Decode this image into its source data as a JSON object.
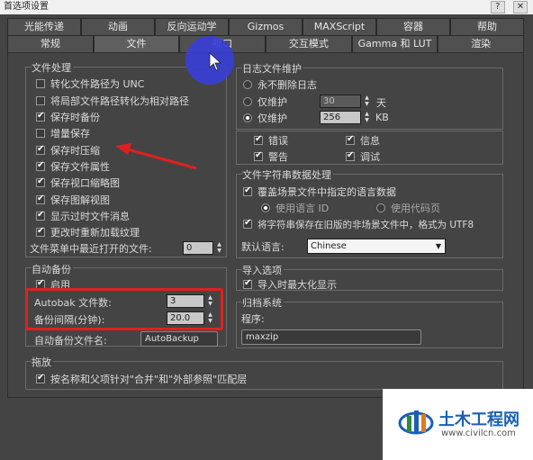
{
  "window": {
    "title": "首选项设置",
    "controls": [
      "?",
      "✕"
    ]
  },
  "tabs_row1": [
    "光能传递",
    "动画",
    "反向运动学",
    "Gizmos",
    "MAXScript",
    "容器",
    "帮助"
  ],
  "tabs_row2": [
    "常规",
    "文件",
    "视口",
    "交互模式",
    "Gamma 和 LUT",
    "渲染"
  ],
  "file_handling": {
    "title": "文件处理",
    "items": [
      {
        "label": "转化文件路径为 UNC",
        "checked": false
      },
      {
        "label": "将局部文件路径转化为相对路径",
        "checked": false
      },
      {
        "label": "保存时备份",
        "checked": true
      },
      {
        "label": "增量保存",
        "checked": false
      },
      {
        "label": "保存时压缩",
        "checked": true
      },
      {
        "label": "保存文件属性",
        "checked": true
      },
      {
        "label": "保存视口缩略图",
        "checked": true
      },
      {
        "label": "保存图解视图",
        "checked": true
      },
      {
        "label": "显示过时文件消息",
        "checked": true
      },
      {
        "label": "更改时重新加载纹理",
        "checked": true
      }
    ],
    "recent_label": "文件菜单中最近打开的文件:",
    "recent_value": "0"
  },
  "autobackup": {
    "title": "自动备份",
    "enable_label": "启用",
    "enable_checked": true,
    "count_label": "Autobak 文件数:",
    "count_value": "3",
    "interval_label": "备份间隔(分钟):",
    "interval_value": "20.0",
    "name_label": "自动备份文件名:",
    "name_value": "AutoBackup"
  },
  "log": {
    "title": "日志文件维护",
    "never_delete": "永不删除日志",
    "keep_days_label": "仅维护",
    "keep_days_value": "30",
    "keep_days_unit": "天",
    "keep_kb_label": "仅维护",
    "keep_kb_value": "256",
    "keep_kb_unit": "KB",
    "selected": "kb",
    "flags": [
      {
        "label": "错误",
        "checked": true
      },
      {
        "label": "信息",
        "checked": true
      },
      {
        "label": "警告",
        "checked": true
      },
      {
        "label": "调试",
        "checked": true
      }
    ]
  },
  "string_data": {
    "title": "文件字符串数据处理",
    "override_label": "覆盖场景文件中指定的语言数据",
    "override_checked": true,
    "use_lang_id": "使用语言 ID",
    "use_codepage": "使用代码页",
    "legacy_label": "将字符串保存在旧版的非场景文件中，格式为 UTF8",
    "legacy_checked": true,
    "default_lang_label": "默认语言:",
    "default_lang_value": "Chinese"
  },
  "import": {
    "title": "导入选项",
    "maximize_label": "导入时最大化显示",
    "maximize_checked": true
  },
  "archive": {
    "title": "归档系统",
    "program_label": "程序:",
    "program_value": "maxzip"
  },
  "track": {
    "title": "拖放",
    "match_label": "按名称和父项针对\"合并\"和\"外部参照\"匹配层",
    "match_checked": true
  },
  "watermark": {
    "title": "土木工程网",
    "url": "www.civilcn.com"
  },
  "colors": {
    "annotation_red": "#e02020",
    "cursor_halo": "#3a3fd6",
    "brand_blue": "#1a5fb4"
  }
}
